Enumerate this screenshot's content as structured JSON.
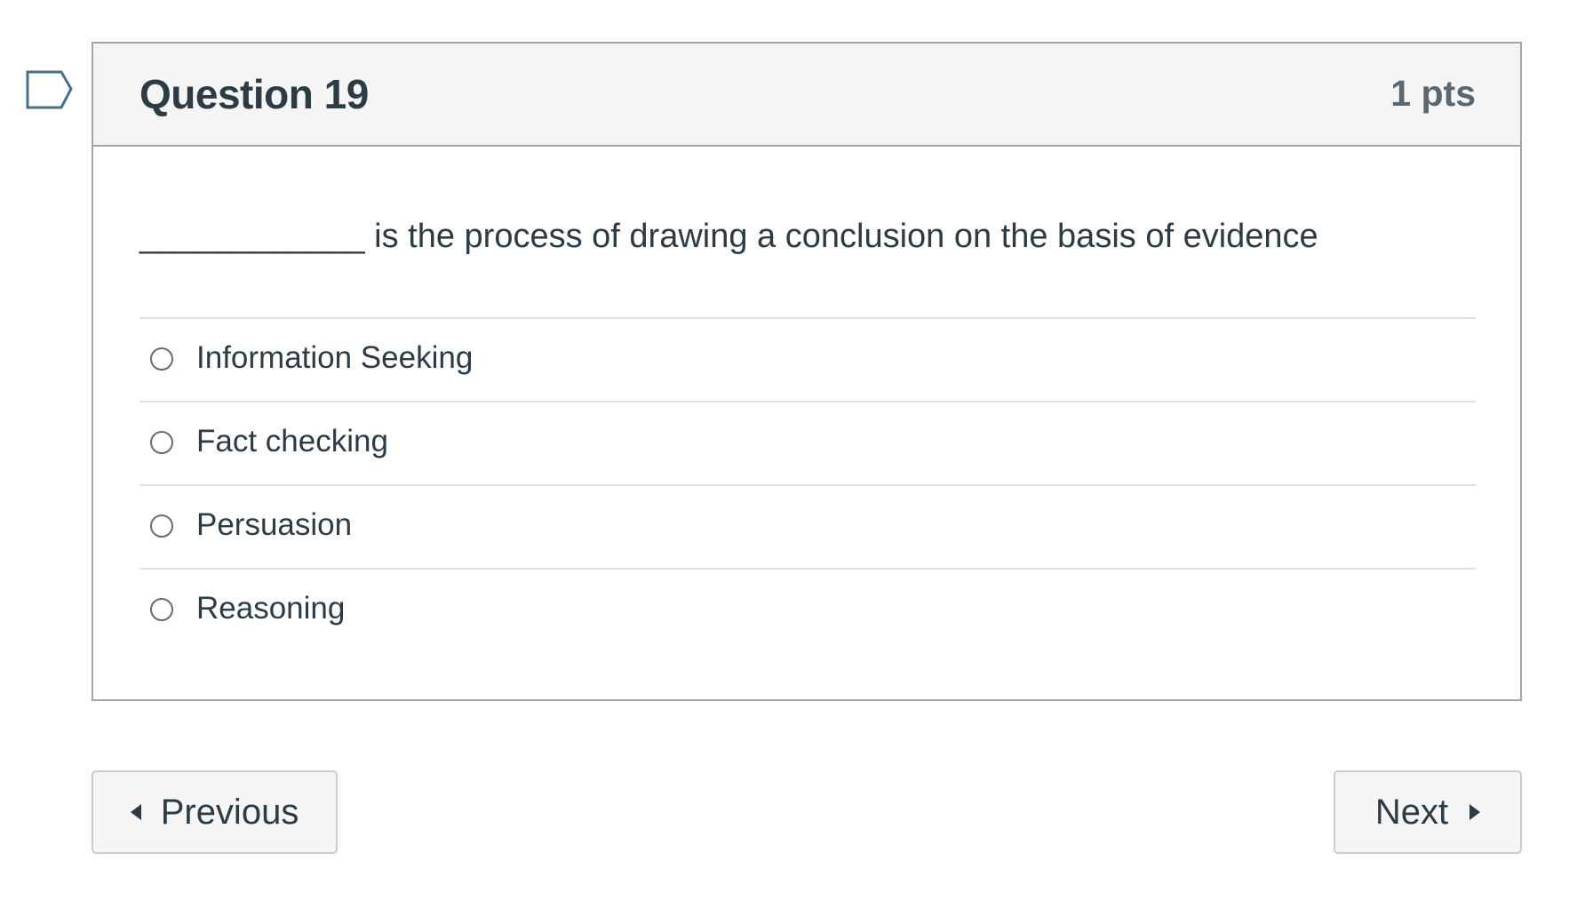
{
  "question": {
    "title": "Question 19",
    "points": "1 pts",
    "text": "____________ is the process of drawing a conclusion on the basis of evidence",
    "flag_icon": "flag-question-icon",
    "answers": [
      {
        "label": "Information Seeking"
      },
      {
        "label": "Fact checking"
      },
      {
        "label": "Persuasion"
      },
      {
        "label": "Reasoning"
      }
    ]
  },
  "navigation": {
    "previous_label": "Previous",
    "next_label": "Next"
  },
  "colors": {
    "text": "#2d3b45",
    "header_bg": "#f5f5f5",
    "border": "#a5a5a5",
    "flag": "#4a6f8a"
  }
}
